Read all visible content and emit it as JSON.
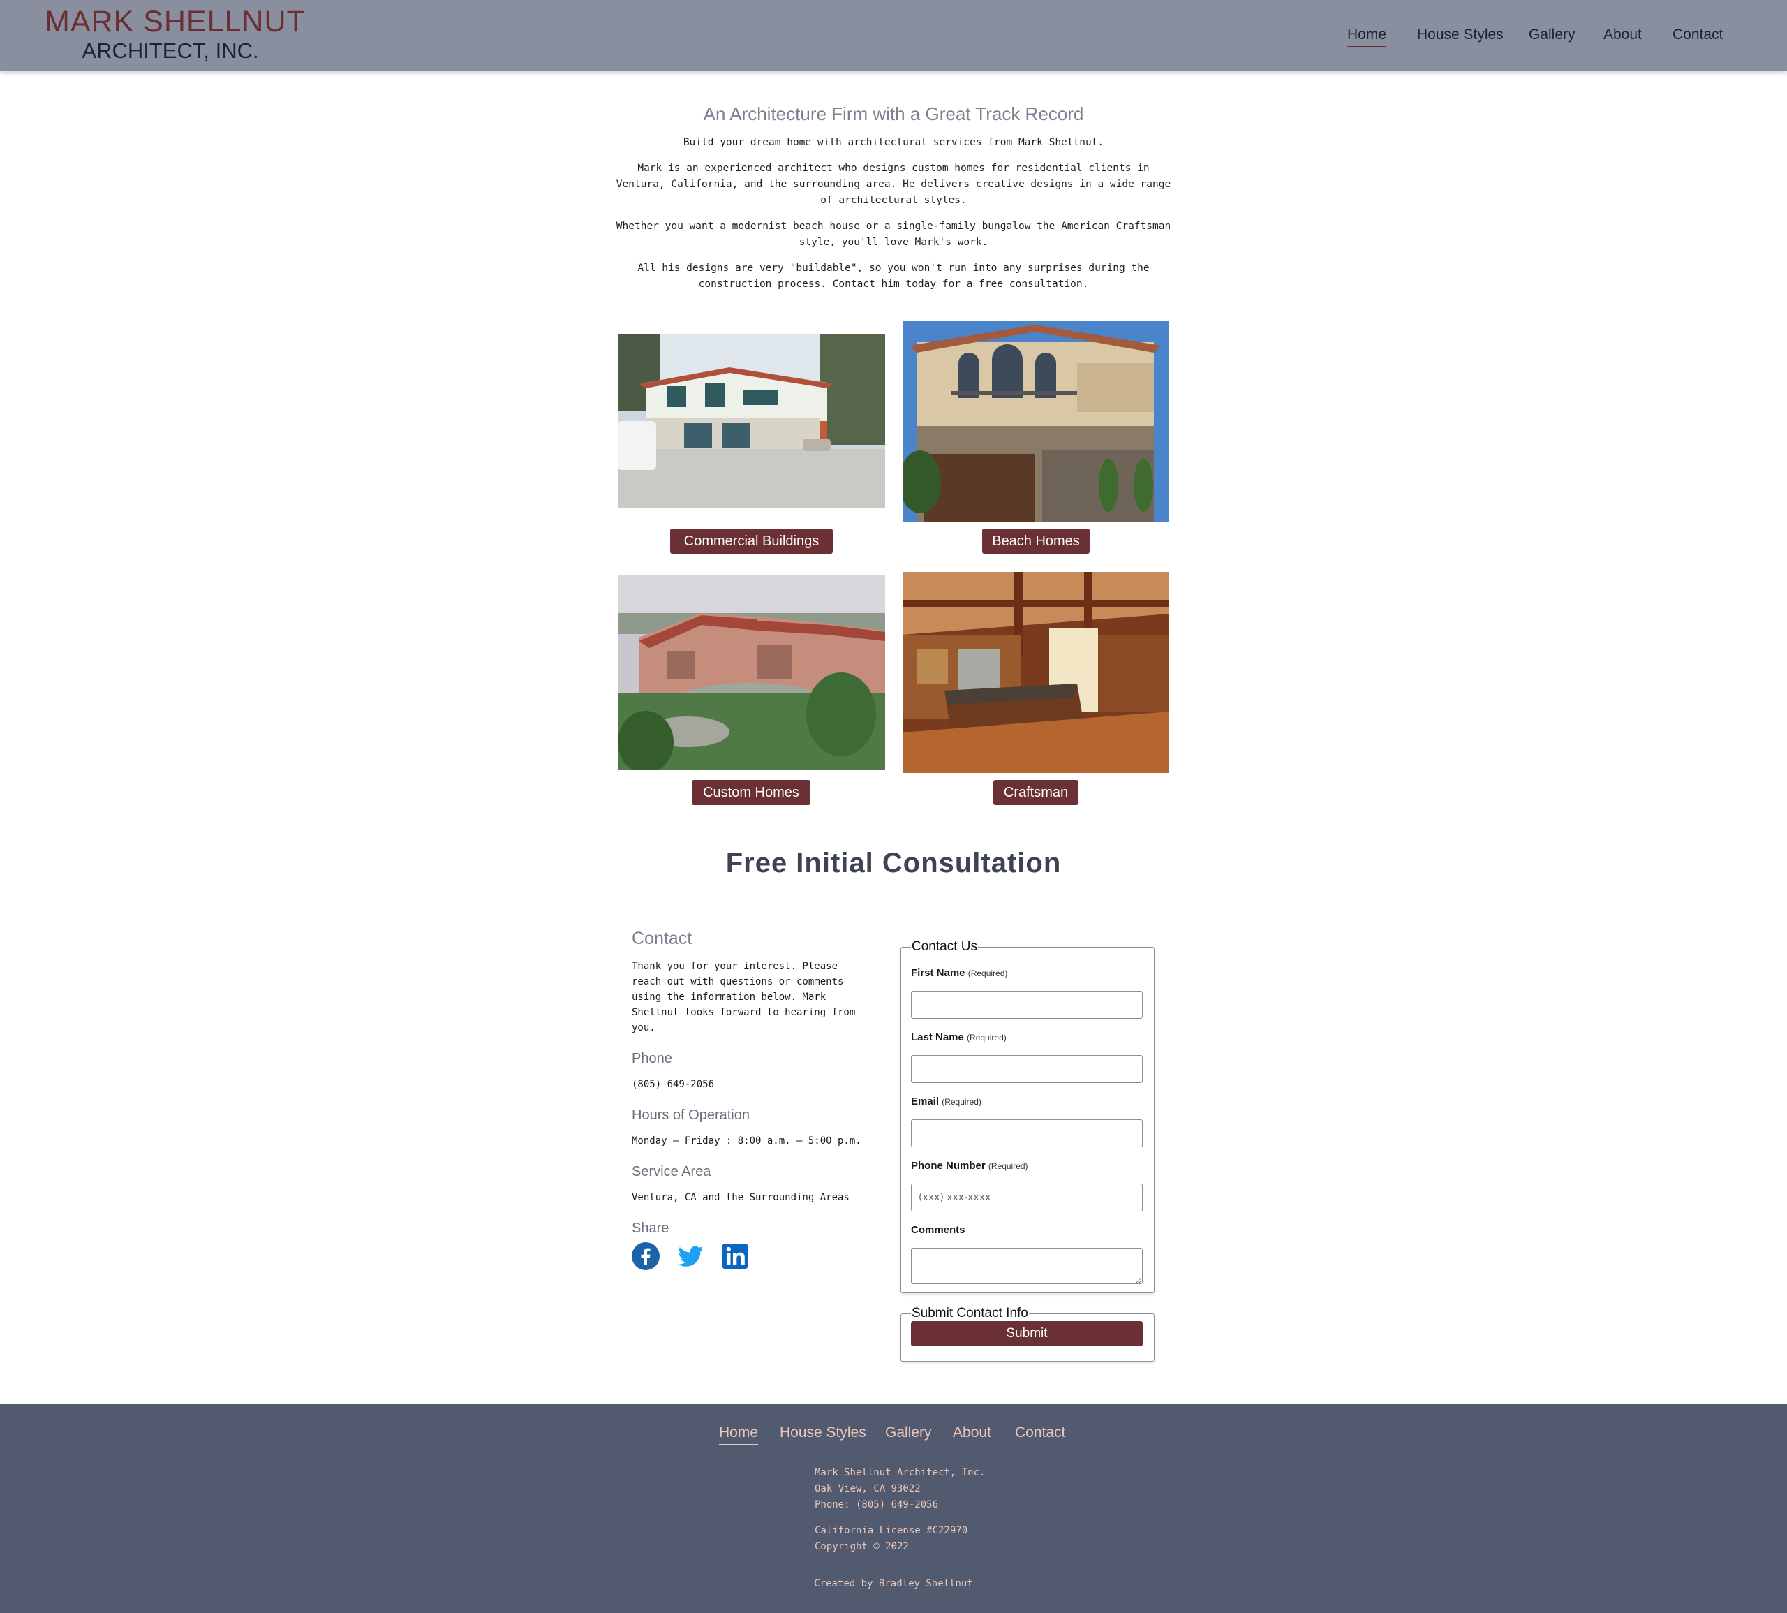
{
  "brand": {
    "line1": "MARK SHELLNUT",
    "line2": "ARCHITECT, INC.",
    "accent_color": "#6b2f33",
    "header_bg": "#898f9e",
    "footer_bg": "#525a6f"
  },
  "nav": {
    "items": [
      {
        "label": "Home",
        "active": true
      },
      {
        "label": "House Styles"
      },
      {
        "label": "Gallery"
      },
      {
        "label": "About"
      },
      {
        "label": "Contact"
      }
    ]
  },
  "intro": {
    "heading": "An Architecture Firm with a Great Track Record",
    "p1": "Build your dream home with architectural services from Mark Shellnut.",
    "p2": "Mark is an experienced architect who designs custom homes for residential clients in Ventura, California, and the surrounding area. He delivers creative designs in a wide range of architectural styles.",
    "p3": "Whether you want a modernist beach house or a single-family bungalow the American Craftsman style, you'll love Mark's work.",
    "p4_before": "All his designs are very \"buildable\", so you won't run into any surprises during the construction process.",
    "p4_link": "Contact",
    "p4_after": "him today for a free consultation."
  },
  "gallery": {
    "tiles": [
      {
        "label": "Commercial Buildings",
        "image": "white stucco commercial building with garage"
      },
      {
        "label": "Beach Homes",
        "image": "two-story mediterranean beach home"
      },
      {
        "label": "Custom Homes",
        "image": "hillside custom home with red tile roof"
      },
      {
        "label": "Craftsman",
        "image": "craftsman style wood kitchen interior"
      }
    ]
  },
  "consult": {
    "title": "Free Initial Consultation"
  },
  "contact": {
    "heading": "Contact",
    "intro": "Thank you for your interest. Please reach out with questions or comments using the information below. Mark Shellnut looks forward to hearing from you.",
    "phone_heading": "Phone",
    "phone": "(805) 649-2056",
    "hours_heading": "Hours of Operation",
    "hours": "Monday — Friday : 8:00 a.m. – 5:00 p.m.",
    "area_heading": "Service Area",
    "area": "Ventura, CA and the Surrounding Areas",
    "share_heading": "Share",
    "social": [
      "facebook-icon",
      "twitter-icon",
      "linkedin-icon"
    ]
  },
  "form": {
    "legend": "Contact Us",
    "required": "(Required)",
    "first_name": "First Name",
    "last_name": "Last Name",
    "email": "Email",
    "phone": "Phone Number",
    "phone_placeholder": "(xxx) xxx-xxxx",
    "comments": "Comments",
    "submit_legend": "Submit Contact Info",
    "submit_label": "Submit"
  },
  "footer": {
    "company": "Mark Shellnut Architect, Inc.",
    "city": "Oak View, CA 93022",
    "phone": "Phone: (805) 649-2056",
    "license": "California License #C22970",
    "copyright": "Copyright © 2022",
    "credit": "Created by Bradley Shellnut"
  }
}
